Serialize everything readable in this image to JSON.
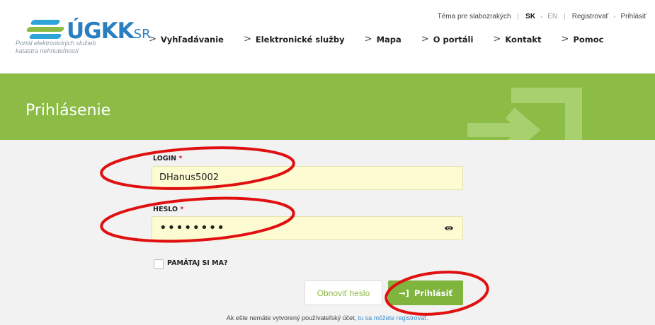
{
  "header": {
    "logo_text": "ÚGKK",
    "logo_suffix": "SR",
    "tagline": "Portál elektronických služieb katastra nehnuteľností",
    "topbar": {
      "theme_link": "Téma pre slabozrakých",
      "lang_sk": "SK",
      "lang_en": "EN",
      "register": "Registrovať",
      "login": "Prihlásiť"
    },
    "nav": [
      {
        "label": "Vyhľadávanie"
      },
      {
        "label": "Elektronické služby"
      },
      {
        "label": "Mapa"
      },
      {
        "label": "O portáli"
      },
      {
        "label": "Kontakt"
      },
      {
        "label": "Pomoc"
      }
    ]
  },
  "banner": {
    "title": "Prihlásenie"
  },
  "form": {
    "login_label": "LOGIN",
    "login_value": "DHanus5002",
    "password_label": "HESLO",
    "password_value": "••••••••",
    "required_mark": "*",
    "remember_label": "PAMÄTAJ SI MA?",
    "reset_button": "Obnoviť heslo",
    "submit_button": "Prihlásiť",
    "note_text": "Ak ešte nemáte vytvorený používateľský účet, ",
    "note_link": "tu sa môžete registrovať."
  },
  "icons": {
    "eye": "eye-icon",
    "login": "login-icon",
    "chevron": "chevron-right-icon"
  },
  "colors": {
    "accent_green": "#8cbc46",
    "button_green": "#7fb43d",
    "input_bg": "#fdfbd1",
    "annotation_red": "#e01010"
  }
}
